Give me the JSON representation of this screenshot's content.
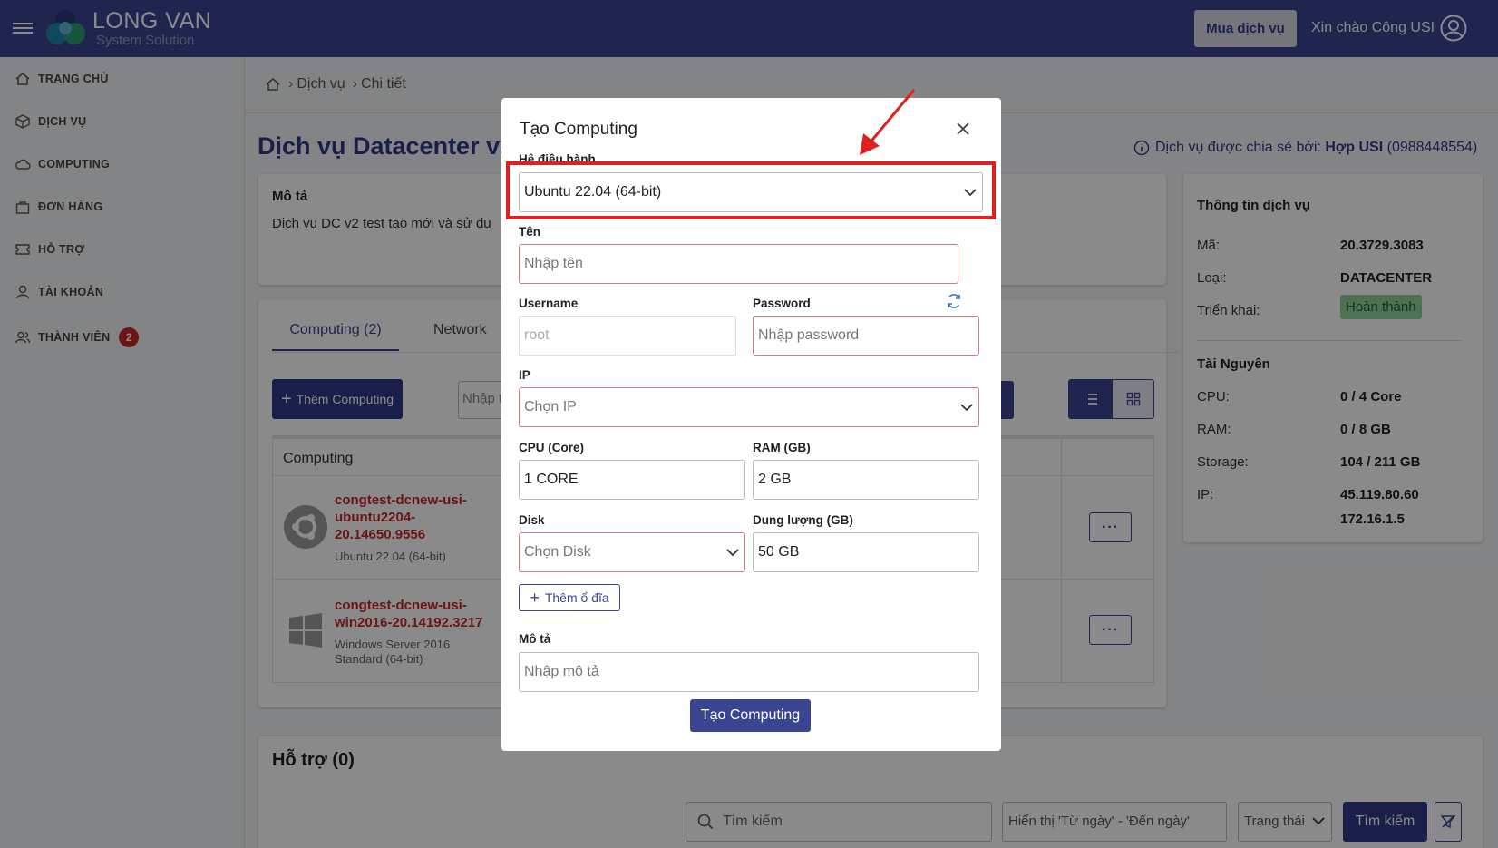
{
  "header": {
    "brand_line1": "LONG VAN",
    "brand_line2": "System Solution",
    "buy_label": "Mua dịch vụ",
    "greeting": "Xin chào Công USI"
  },
  "sidebar": {
    "items": [
      {
        "label": "TRANG CHỦ",
        "icon": "home-icon"
      },
      {
        "label": "DỊCH VỤ",
        "icon": "cube-icon"
      },
      {
        "label": "COMPUTING",
        "icon": "cloud-icon"
      },
      {
        "label": "ĐƠN HÀNG",
        "icon": "bag-icon"
      },
      {
        "label": "HỖ TRỢ",
        "icon": "ticket-icon"
      },
      {
        "label": "TÀI KHOẢN",
        "icon": "user-icon"
      },
      {
        "label": "THÀNH VIÊN",
        "icon": "users-icon",
        "badge": "2"
      }
    ]
  },
  "breadcrumb": {
    "items": [
      "Dịch vụ",
      "Chi tiết"
    ]
  },
  "page": {
    "title": "Dịch vụ Datacenter v2",
    "shared_prefix": "Dịch vụ được chia sẻ bởi:",
    "shared_name": "Hợp USI",
    "shared_phone": "(0988448554)"
  },
  "description": {
    "heading": "Mô tả",
    "text": "Dịch vụ DC v2 test tạo mới và sử dụ"
  },
  "tabs": [
    {
      "label": "Computing (2)",
      "active": true
    },
    {
      "label": "Network"
    }
  ],
  "toolbar": {
    "add_label": "Thêm Computing",
    "filter_placeholder": "Nhập t"
  },
  "table": {
    "header": "Computing",
    "rows": [
      {
        "name": "congtest-dcnew-usi-ubuntu2204-20.14650.9556",
        "name_lines": [
          "congtest-dcnew-usi-",
          "ubuntu2204-",
          "20.14650.9556"
        ],
        "os": "Ubuntu 22.04 (64-bit)",
        "os_lines": [
          "Ubuntu 22.04 (64-bit)"
        ],
        "icon": "ubuntu-icon"
      },
      {
        "name": "congtest-dcnew-usi-win2016-20.14192.3217",
        "name_lines": [
          "congtest-dcnew-usi-",
          "win2016-20.14192.3217"
        ],
        "os": "Windows Server 2016 Standard (64-bit)",
        "os_lines": [
          "Windows Server 2016",
          "Standard (64-bit)"
        ],
        "icon": "windows-icon"
      }
    ],
    "more_label": "···"
  },
  "service_info": {
    "title": "Thông tin dịch vụ",
    "code_label": "Mã:",
    "code": "20.3729.3083",
    "type_label": "Loại:",
    "type": "DATACENTER",
    "deploy_label": "Triển khai:",
    "deploy_status": "Hoàn thành",
    "resources_title": "Tài Nguyên",
    "cpu_label": "CPU:",
    "cpu": "0 / 4 Core",
    "ram_label": "RAM:",
    "ram": "0 / 8 GB",
    "storage_label": "Storage:",
    "storage": "104 / 211 GB",
    "ip_label": "IP:",
    "ip1": "45.119.80.60",
    "ip2": "172.16.1.5"
  },
  "support": {
    "title": "Hỗ trợ (0)",
    "search_placeholder": "Tìm kiếm",
    "date_range": "Hiển thị 'Từ ngày' - 'Đến ngày'",
    "status_placeholder": "Trạng thái",
    "search_btn": "Tìm kiếm"
  },
  "modal": {
    "title": "Tạo Computing",
    "os_label": "Hệ điều hành",
    "os_value": "Ubuntu 22.04 (64-bit)",
    "name_label": "Tên",
    "name_placeholder": "Nhập tên",
    "username_label": "Username",
    "username_value": "root",
    "password_label": "Password",
    "password_placeholder": "Nhập password",
    "ip_label": "IP",
    "ip_placeholder": "Chọn IP",
    "cpu_label": "CPU (Core)",
    "cpu_value": "1 CORE",
    "ram_label": "RAM (GB)",
    "ram_value": "2 GB",
    "disk_label": "Disk",
    "disk_placeholder": "Chọn Disk",
    "capacity_label": "Dung lượng (GB)",
    "capacity_value": "50 GB",
    "add_disk_label": "Thêm ổ đĩa",
    "desc_label": "Mô tả",
    "desc_placeholder": "Nhập mô tả",
    "submit_label": "Tạo Computing"
  },
  "colors": {
    "primary": "#3a4591",
    "highlight": "#e02020",
    "danger": "#c62828",
    "success_bg": "#8fd39a"
  }
}
